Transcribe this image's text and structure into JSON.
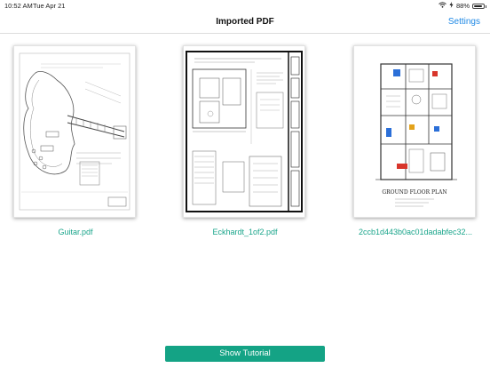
{
  "status_bar": {
    "time": "10:52 AM",
    "date": "Tue Apr 21",
    "battery_percent": "88%",
    "battery_level": 0.88,
    "icons": [
      "wifi-icon",
      "charging-icon",
      "battery-icon"
    ]
  },
  "nav": {
    "title": "Imported PDF",
    "settings_label": "Settings"
  },
  "documents": [
    {
      "name": "Guitar.pdf",
      "thumbnail": "guitar-blueprint"
    },
    {
      "name": "Eckhardt_1of2.pdf",
      "thumbnail": "architectural-drawing"
    },
    {
      "name": "2ccb1d443b0ac01dadabfec32...",
      "thumbnail": "floor-plan",
      "plan_title": "GROUND FLOOR PLAN"
    }
  ],
  "footer": {
    "tutorial_label": "Show Tutorial"
  },
  "colors": {
    "accent": "#14a385",
    "link": "#1e88e5",
    "filename": "#1aa58b"
  }
}
